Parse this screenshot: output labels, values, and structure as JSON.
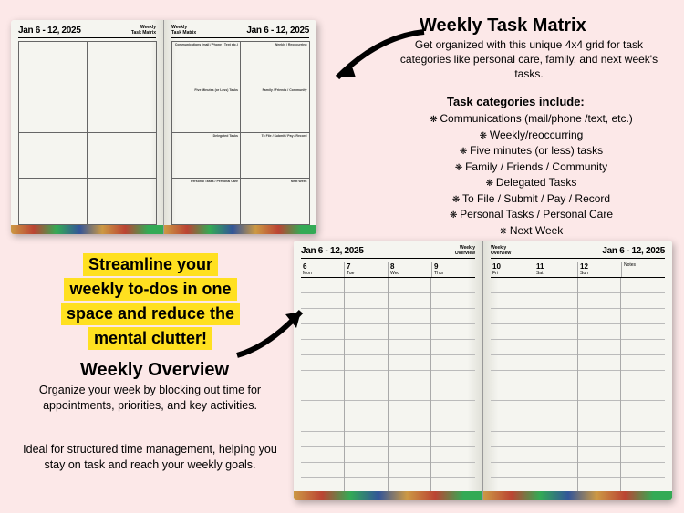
{
  "dateRange": "Jan 6 - 12, 2025",
  "labels": {
    "weekly": "Weekly",
    "taskMatrix": "Task Matrix",
    "overview": "Overview"
  },
  "matrixCells": {
    "r0c0": "Communications (mail / Phone / Text etc.)",
    "r0c1": "Weekly / Reoccurring",
    "r1c0": "Five Minutes (or Less) Tasks",
    "r1c1": "Family / Friends / Community",
    "r2c0": "Delegated Tasks",
    "r2c1": "To File / Submit / Pay / Record",
    "r3c0": "Personal Tasks / Personal Care",
    "r3c1": "Next Week"
  },
  "days": {
    "left": [
      {
        "num": "6",
        "name": "Mon"
      },
      {
        "num": "7",
        "name": "Tue"
      },
      {
        "num": "8",
        "name": "Wed"
      },
      {
        "num": "9",
        "name": "Thur"
      }
    ],
    "right": [
      {
        "num": "10",
        "name": "Fri"
      },
      {
        "num": "11",
        "name": "Sat"
      },
      {
        "num": "12",
        "name": "Sun"
      },
      {
        "num": "",
        "name": "Notes"
      }
    ]
  },
  "promo": {
    "title1": "Weekly Task Matrix",
    "desc1": "Get organized with this unique 4x4 grid for task categories like personal care, family, and next week's tasks.",
    "subtitle1": "Task categories include:",
    "cats": [
      "Communications (mail/phone /text, etc.)",
      "Weekly/reoccurring",
      "Five minutes (or less) tasks",
      "Family / Friends / Community",
      "Delegated Tasks",
      "To File / Submit / Pay / Record",
      "Personal Tasks / Personal Care",
      "Next Week"
    ],
    "hl1": "Streamline your",
    "hl2": "weekly to-dos in one",
    "hl3": "space and reduce the",
    "hl4": "mental clutter!",
    "title2": "Weekly Overview",
    "desc2": "Organize your week by blocking out time for appointments, priorities, and key activities.",
    "desc3": "Ideal for structured time management, helping you stay on task and reach your weekly goals."
  }
}
